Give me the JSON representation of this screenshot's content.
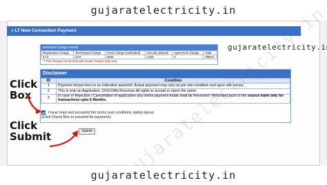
{
  "site": {
    "top_label": "gujaratelectricity.in",
    "bottom_label": "gujaratelectricity.in",
    "inner_watermark": "gujaratelectricity.in"
  },
  "header": {
    "title": "» LT New Connection Payment"
  },
  "estimated": {
    "title": "Estimated Charge Details",
    "columns": [
      "Registration Charge",
      "Test Report Charge",
      "Fixed Charge (estimated)",
      "Security Deposit",
      "Agreement Charge",
      "Total"
    ],
    "values": [
      "47.2",
      "23.6",
      "3500",
      "1428",
      "0",
      "4998.8"
    ],
    "note": "** This charges are provisional.Actual Charges may vary."
  },
  "disclaimer": {
    "title": "Disclaimer",
    "col_id": "ID",
    "col_condition": "Condition",
    "rows": [
      {
        "id": "1",
        "text": "Payment shown here is an indicative payment. Actual payment may vary as per site condition and upon site survey."
      },
      {
        "id": "2",
        "text": "This is only an Application. DISCOMs Reserves All rights to accept or reject the same."
      },
      {
        "id": "3",
        "text": "In case of Rejection / Cancellation of application any online payment made shall be Reversed / Refunded back to the",
        "bold": "source bank only for transactions upto 6 Months."
      }
    ],
    "accept": "I have read and accepted the terms and conditions stated above.",
    "accept_hint": "(Click Check Box to proceed for payment.)"
  },
  "submit_label": "Submit",
  "annotations": {
    "click_box_1": "Click",
    "click_box_2": "Box",
    "click_submit_1": "Click",
    "click_submit_2": "Submit"
  },
  "colors": {
    "header": "#3b6fc4",
    "arrow": "#e01010"
  }
}
